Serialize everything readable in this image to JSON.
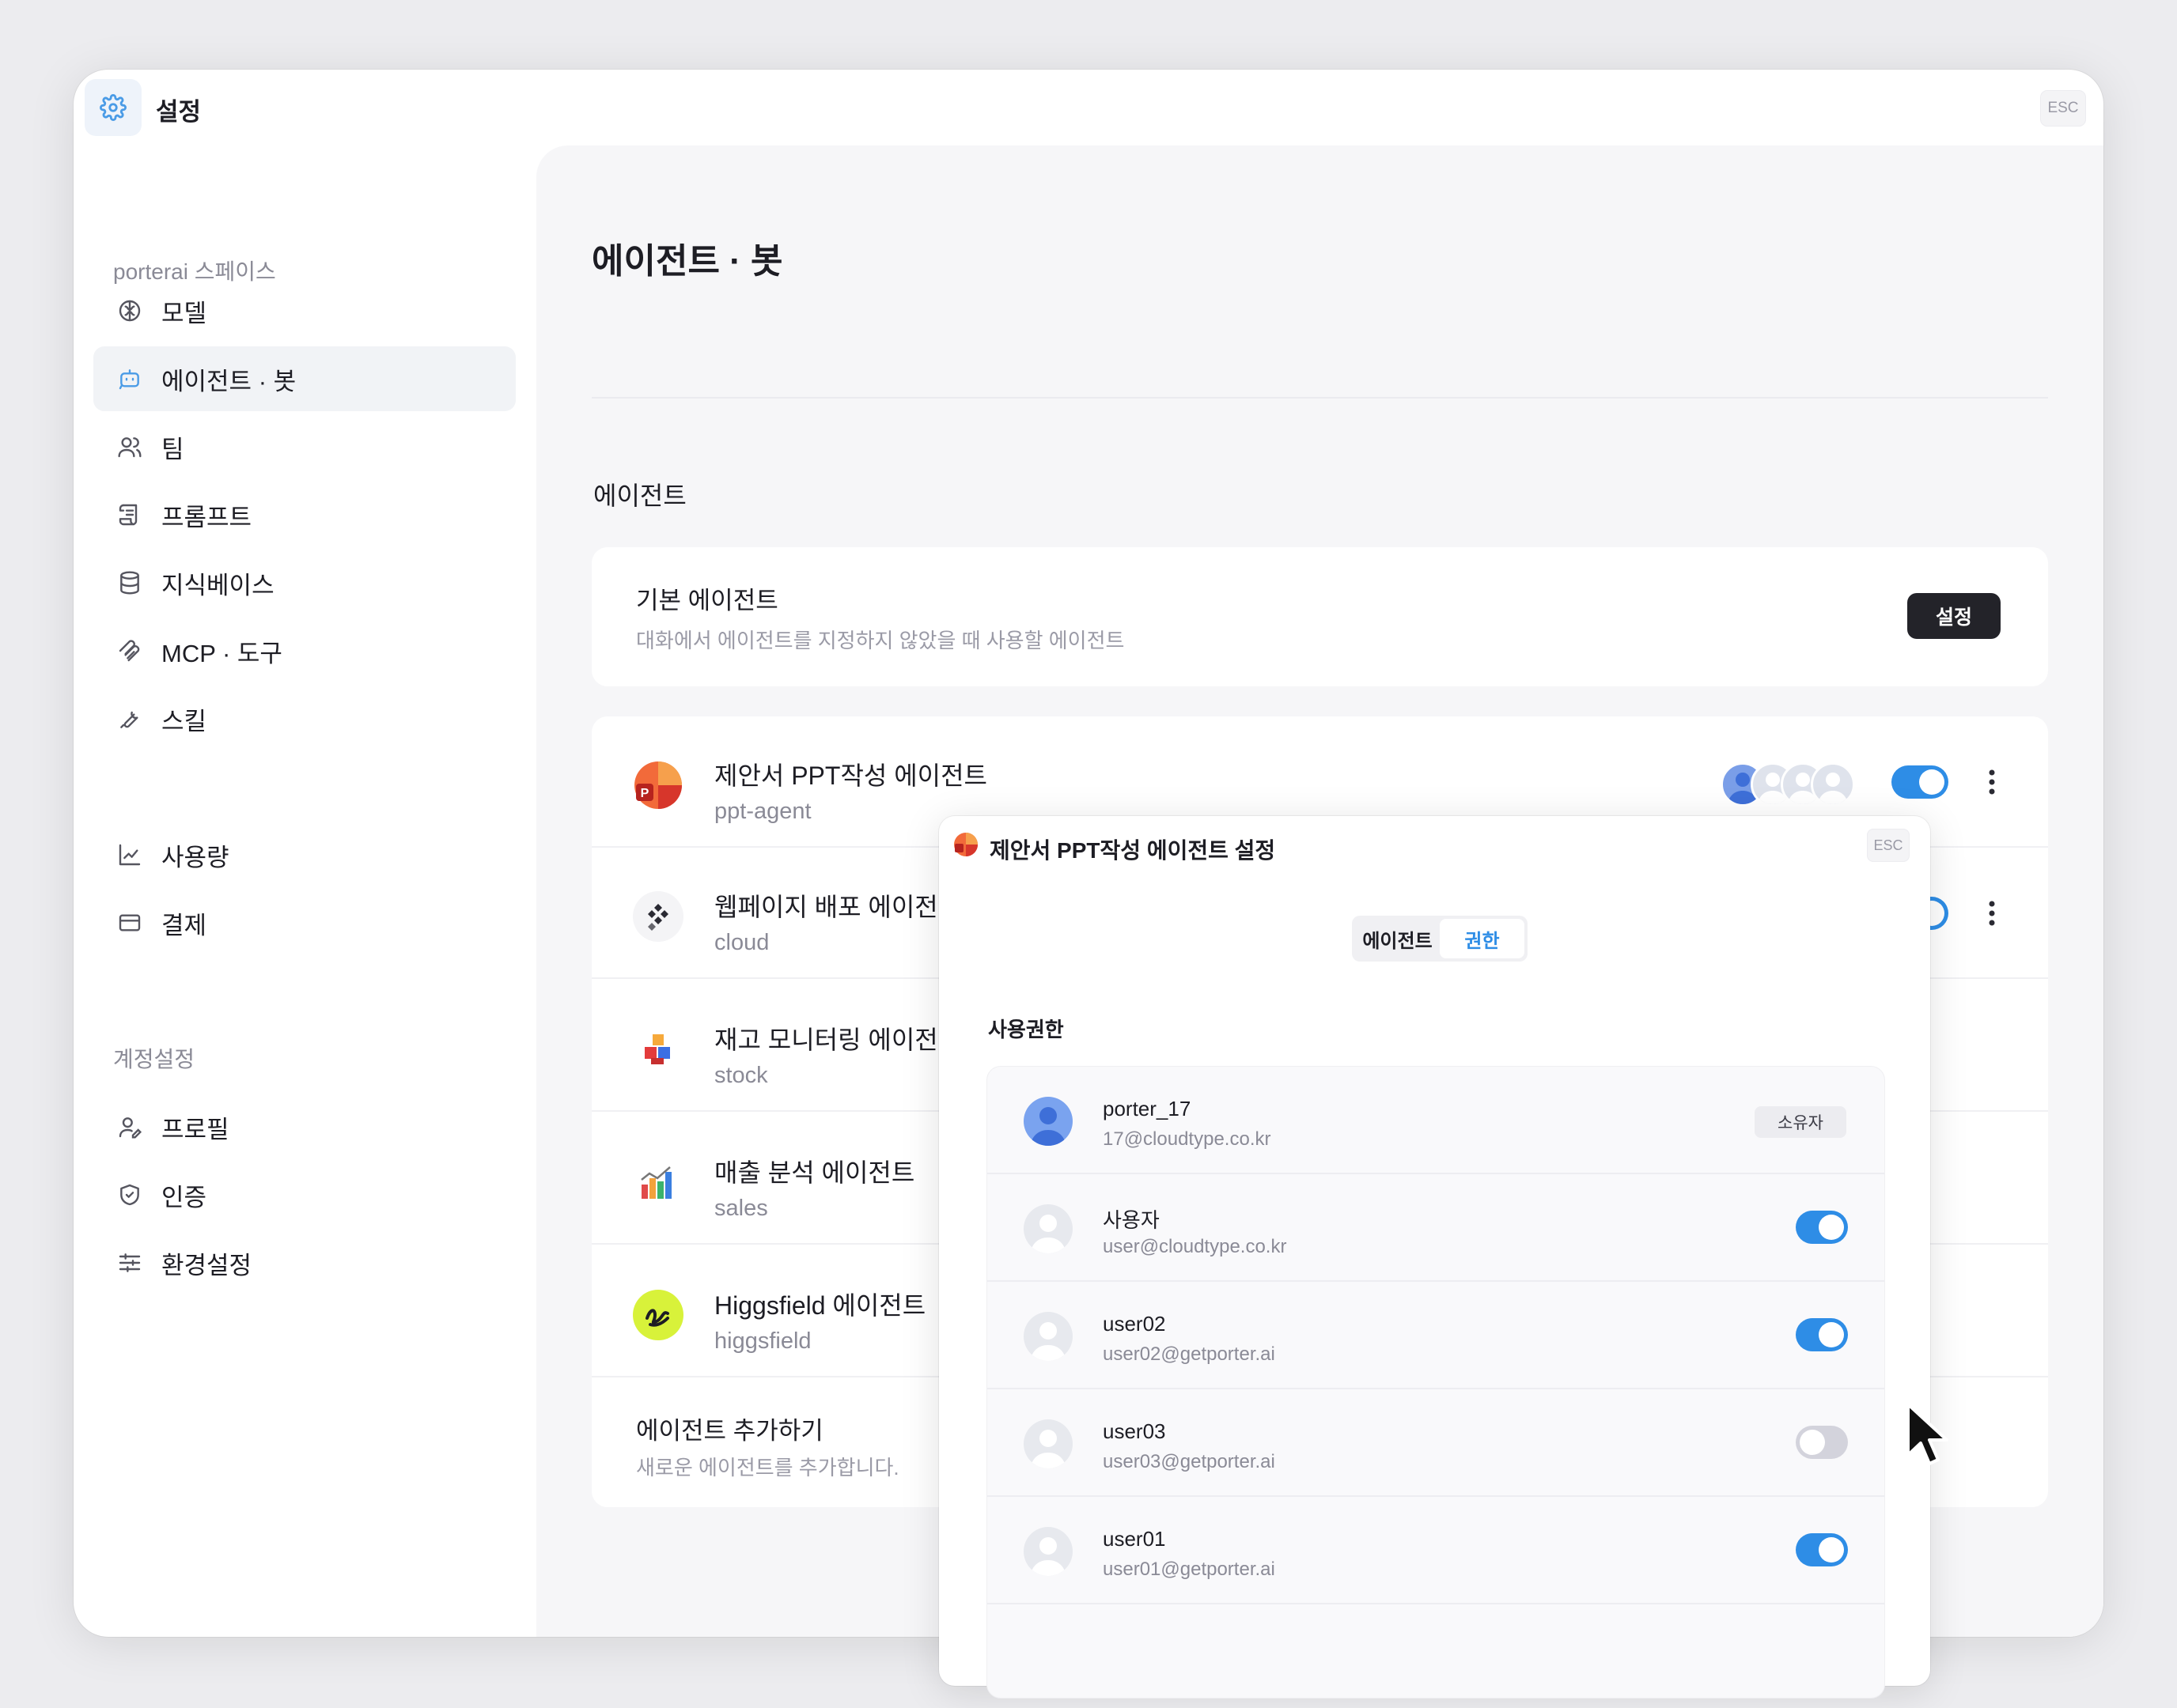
{
  "window": {
    "title": "설정",
    "esc_label": "ESC"
  },
  "sidebar": {
    "workspace_label": "porterai 스페이스",
    "account_label": "계정설정",
    "items": [
      {
        "label": "모델",
        "icon": "brain-icon"
      },
      {
        "label": "에이전트 · 봇",
        "icon": "bot-icon",
        "active": true
      },
      {
        "label": "팀",
        "icon": "users-icon"
      },
      {
        "label": "프롬프트",
        "icon": "scroll-icon"
      },
      {
        "label": "지식베이스",
        "icon": "database-icon"
      },
      {
        "label": "MCP · 도구",
        "icon": "mcp-icon"
      },
      {
        "label": "스킬",
        "icon": "tool-icon"
      },
      {
        "label": "사용량",
        "icon": "chart-icon"
      },
      {
        "label": "결제",
        "icon": "card-icon"
      },
      {
        "label": "프로필",
        "icon": "profile-icon"
      },
      {
        "label": "인증",
        "icon": "shield-icon"
      },
      {
        "label": "환경설정",
        "icon": "sliders-icon"
      }
    ]
  },
  "main": {
    "page_title": "에이전트 · 봇",
    "section_label": "에이전트",
    "default_agent": {
      "title": "기본 에이전트",
      "description": "대화에서 에이전트를 지정하지 않았을 때 사용할 에이전트",
      "button_label": "설정"
    },
    "agents": [
      {
        "name": "제안서 PPT작성 에이전트",
        "id": "ppt-agent",
        "enabled": true
      },
      {
        "name": "웹페이지 배포 에이전트",
        "id": "cloud",
        "enabled": true
      },
      {
        "name": "재고 모니터링 에이전트",
        "id": "stock"
      },
      {
        "name": "매출 분석 에이전트",
        "id": "sales"
      },
      {
        "name": "Higgsfield 에이전트",
        "id": "higgsfield"
      }
    ],
    "add_agent": {
      "title": "에이전트 추가하기",
      "description": "새로운 에이전트를 추가합니다."
    }
  },
  "modal": {
    "title": "제안서 PPT작성 에이전트 설정",
    "esc_label": "ESC",
    "tabs": [
      "에이전트",
      "권한"
    ],
    "active_tab": "권한",
    "section_label": "사용권한",
    "users": [
      {
        "name": "porter_17",
        "email": "17@cloudtype.co.kr",
        "badge": "소유자"
      },
      {
        "name": "사용자",
        "email": "user@cloudtype.co.kr",
        "enabled": true
      },
      {
        "name": "user02",
        "email": "user02@getporter.ai",
        "enabled": true
      },
      {
        "name": "user03",
        "email": "user03@getporter.ai",
        "enabled": false
      },
      {
        "name": "user01",
        "email": "user01@getporter.ai",
        "enabled": true
      }
    ]
  },
  "colors": {
    "accent": "#2e8de6",
    "dark_button": "#232329",
    "toggle_off": "#d3d3dc"
  }
}
